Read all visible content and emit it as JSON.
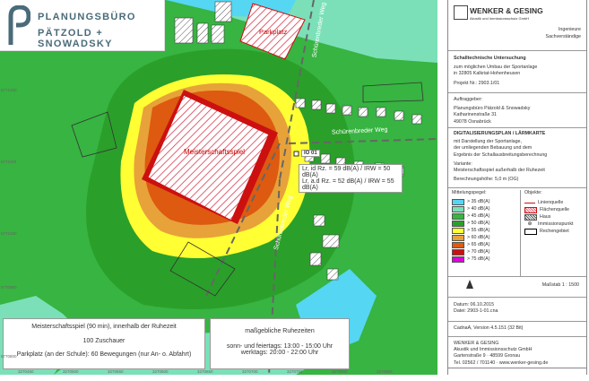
{
  "logo": {
    "line1": "PLANUNGSBÜRO",
    "line2": "PÄTZOLD + SNOWADSKY",
    "color": "#4a6b7a"
  },
  "map": {
    "labels": {
      "parkplatz": "Parkplatz",
      "meisterschaftsspiel": "Meisterschaftsspiel",
      "street_east": "Schürenbreder Weg",
      "street_south": "Schürenbreder Weg",
      "street_north": "Schürenbreder Weg",
      "io": "IO 01"
    },
    "io_values": {
      "line1": "Lr, id Rz. = 59 dB(A) / IRW = 50 dB(A)",
      "line2": "Lr, a.d Rz. = 52 dB(A) / IRW = 55 dB(A)"
    },
    "colors": {
      "c35": "#55d6f2",
      "c40": "#7be0b8",
      "c45": "#37b441",
      "c50": "#2aa02a",
      "c55": "#ffff33",
      "c60": "#e8a23a",
      "c65": "#dd5a10",
      "c70": "#cc1010",
      "c75": "#dd00dd",
      "field": "#ffd9de",
      "road": "#666666"
    },
    "grid_y": [
      "5771200",
      "5771100",
      "5771000",
      "5770900",
      "5770800"
    ],
    "grid_x": [
      "3270450",
      "3270500",
      "3270550",
      "3270600",
      "3270650",
      "3270700",
      "3270750",
      "3270800",
      "3270850"
    ]
  },
  "info_left": {
    "title": "Meisterschaftsspiel (90 min), innerhalb der Ruhezeit",
    "spectators": "100 Zuschauer",
    "parking": "Parkplatz (an der Schule): 60 Bewegungen (nur An- o. Abfahrt)"
  },
  "info_right": {
    "title": "maßgebliche Ruhezeiten",
    "line1": "sonn- und feiertags: 13:00 - 15:00 Uhr",
    "line2": "werktags: 20:00 - 22:00 Uhr"
  },
  "panel": {
    "company": "WENKER & GESING",
    "company_sub": "Akustik und Immissionsschutz GmbH",
    "role1": "Ingenieure",
    "role2": "Sachverständige",
    "study_title": "Schalltechnische Untersuchung",
    "study_l1": "zum möglichen Umbau der Sportanlage",
    "study_l2": "in 32805 Kalkriat-Hohenheusen",
    "project": "Projekt Nr.: 2903.1/01",
    "client_label": "Auftraggeber:",
    "client_l1": "Planungsbüro Pätzold & Snowadsky",
    "client_l2": "Katharinenstraße 31",
    "client_l3": "49078 Osnabrück",
    "digi_title": "DIGITALISIERUNGSPLAN / LÄRMKARTE",
    "digi_l1": "mit Darstellung der Sportanlage,",
    "digi_l2": "der umliegenden Bebauung und dem",
    "digi_l3": "Ergebnis der Schallausbreitungsberechnung",
    "variant_label": "Variante:",
    "variant_value": "Meisterschaftsspiel außerhalb der Ruhezeit",
    "height": "Berechnungshöhe: 5,0 m (OG)",
    "legend_title": "Mittelungspegel:",
    "legend": [
      {
        "label": "> 35 dB(A)",
        "color": "#55d6f2"
      },
      {
        "label": "> 40 dB(A)",
        "color": "#7be0b8"
      },
      {
        "label": "> 45 dB(A)",
        "color": "#37b441"
      },
      {
        "label": "> 50 dB(A)",
        "color": "#2aa02a"
      },
      {
        "label": "> 55 dB(A)",
        "color": "#ffff33"
      },
      {
        "label": "> 60 dB(A)",
        "color": "#e8a23a"
      },
      {
        "label": "> 65 dB(A)",
        "color": "#dd5a10"
      },
      {
        "label": "> 70 dB(A)",
        "color": "#cc1010"
      },
      {
        "label": "> 75 dB(A)",
        "color": "#dd00dd"
      }
    ],
    "objects_title": "Objekte:",
    "objects": [
      "Linienquelle",
      "Flächenquelle",
      "Haus",
      "Immissionspunkt",
      "Rechengebiet"
    ],
    "scale": "Maßstab 1 : 1500",
    "date": "Datum: 06.10.2015",
    "file": "Datei: 2903-1-01.cna",
    "software": "CadnaA, Version 4.5.151 (32 Bit)",
    "addr_l1": "WENKER & GESING",
    "addr_l2": "Akustik und Immissionsschutz GmbH",
    "addr_l3": "Gartenstraße 9 · 48599 Gronau",
    "addr_l4": "Tel. 02562 / 701140 · www.wenker-gesing.de"
  }
}
